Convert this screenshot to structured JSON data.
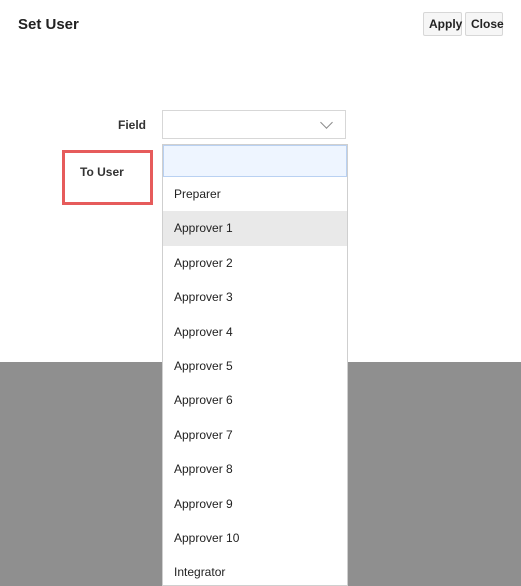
{
  "dialog": {
    "title": "Set User",
    "apply_label": "Apply",
    "close_label": "Close"
  },
  "form": {
    "field_label": "Field",
    "field_value": "",
    "to_user_label": "To User",
    "search_value": ""
  },
  "dropdown": {
    "items": [
      "Preparer",
      "Approver 1",
      "Approver 2",
      "Approver 3",
      "Approver 4",
      "Approver 5",
      "Approver 6",
      "Approver 7",
      "Approver 8",
      "Approver 9",
      "Approver 10",
      "Integrator"
    ],
    "hovered_index": 1
  },
  "icons": {
    "field_select": "chevron-down-icon"
  },
  "colors": {
    "highlight_border": "#e65b5b",
    "overlay_band": "#8f8f8f",
    "input_focus_bg": "#eef5ff",
    "hover_bg": "#e9e9e9"
  }
}
